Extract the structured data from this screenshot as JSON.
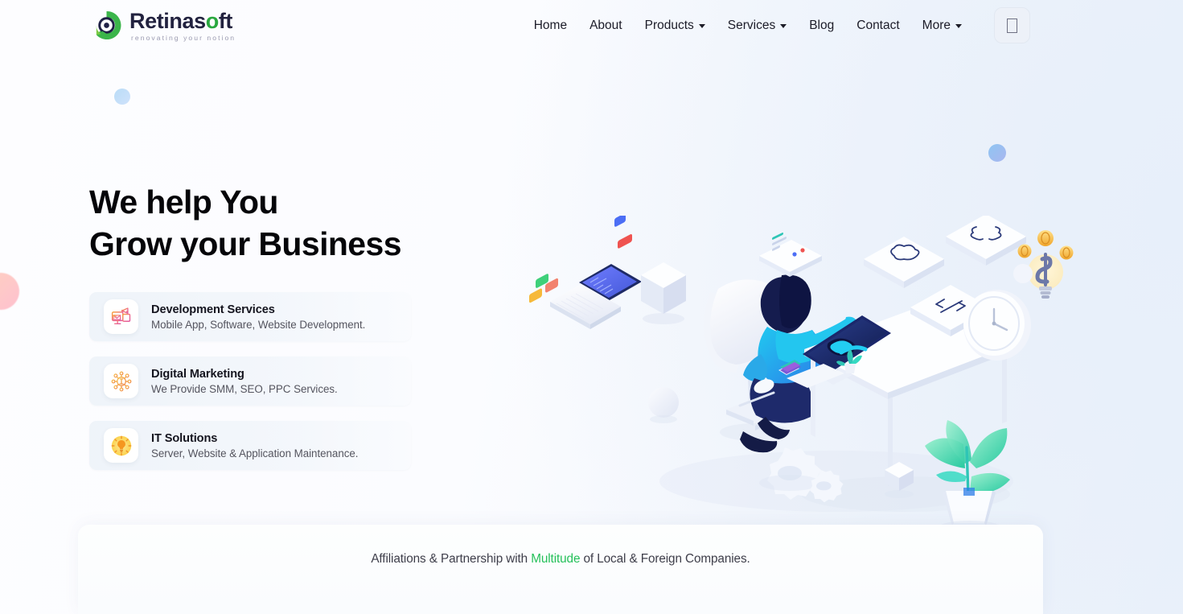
{
  "brand": {
    "name_pre": "Retinas",
    "name_dot": "o",
    "name_post": "ft",
    "tagline": "renovating your notion",
    "logo_icon": "retinasoft-circle-logo",
    "accent_green": "#2aa83f"
  },
  "nav": {
    "items": [
      {
        "label": "Home",
        "has_caret": false
      },
      {
        "label": "About",
        "has_caret": false
      },
      {
        "label": "Products",
        "has_caret": true
      },
      {
        "label": "Services",
        "has_caret": true
      },
      {
        "label": "Blog",
        "has_caret": false
      },
      {
        "label": "Contact",
        "has_caret": false
      },
      {
        "label": "More",
        "has_caret": true
      }
    ],
    "action_button": {
      "icon": "missing-glyph-box-icon",
      "label": ""
    }
  },
  "hero": {
    "title": "We help You\nGrow your Business",
    "cards": [
      {
        "title": "Development Services",
        "subtitle": "Mobile App, Software, Website Development.",
        "icon": "monitor-megaphone-icon",
        "icon_color": "#f2708f"
      },
      {
        "title": "Digital Marketing",
        "subtitle": "We Provide SMM, SEO, PPC Services.",
        "icon": "network-nodes-icon",
        "icon_color": "#f79833"
      },
      {
        "title": "IT Solutions",
        "subtitle": "Server, Website & Application Maintenance.",
        "icon": "lightbulb-icon",
        "icon_color": "#f5a623"
      }
    ],
    "illustration": {
      "name": "isometric-workspace-illustration",
      "elements": [
        "laptop-with-code",
        "white-cube",
        "white-sphere",
        "person-at-desk",
        "monitor",
        "floating-tile-cloud",
        "floating-tile-braces",
        "floating-tile-code",
        "wall-clock",
        "lightbulb-with-dollar",
        "gold-coins",
        "potted-plant",
        "gears",
        "smartphone",
        "small-plant"
      ]
    },
    "decorations": [
      {
        "name": "blob-pink-left",
        "color": "#ffc0b4"
      },
      {
        "name": "blob-blue-small",
        "color": "#b9dcf7"
      },
      {
        "name": "blob-blue-right",
        "color": "#8fc5f2"
      }
    ]
  },
  "partners": {
    "text_before": "Affiliations & Partnership with ",
    "highlight": "Multitude",
    "text_after": " of Local & Foreign Companies.",
    "highlight_color": "#25c05a"
  }
}
